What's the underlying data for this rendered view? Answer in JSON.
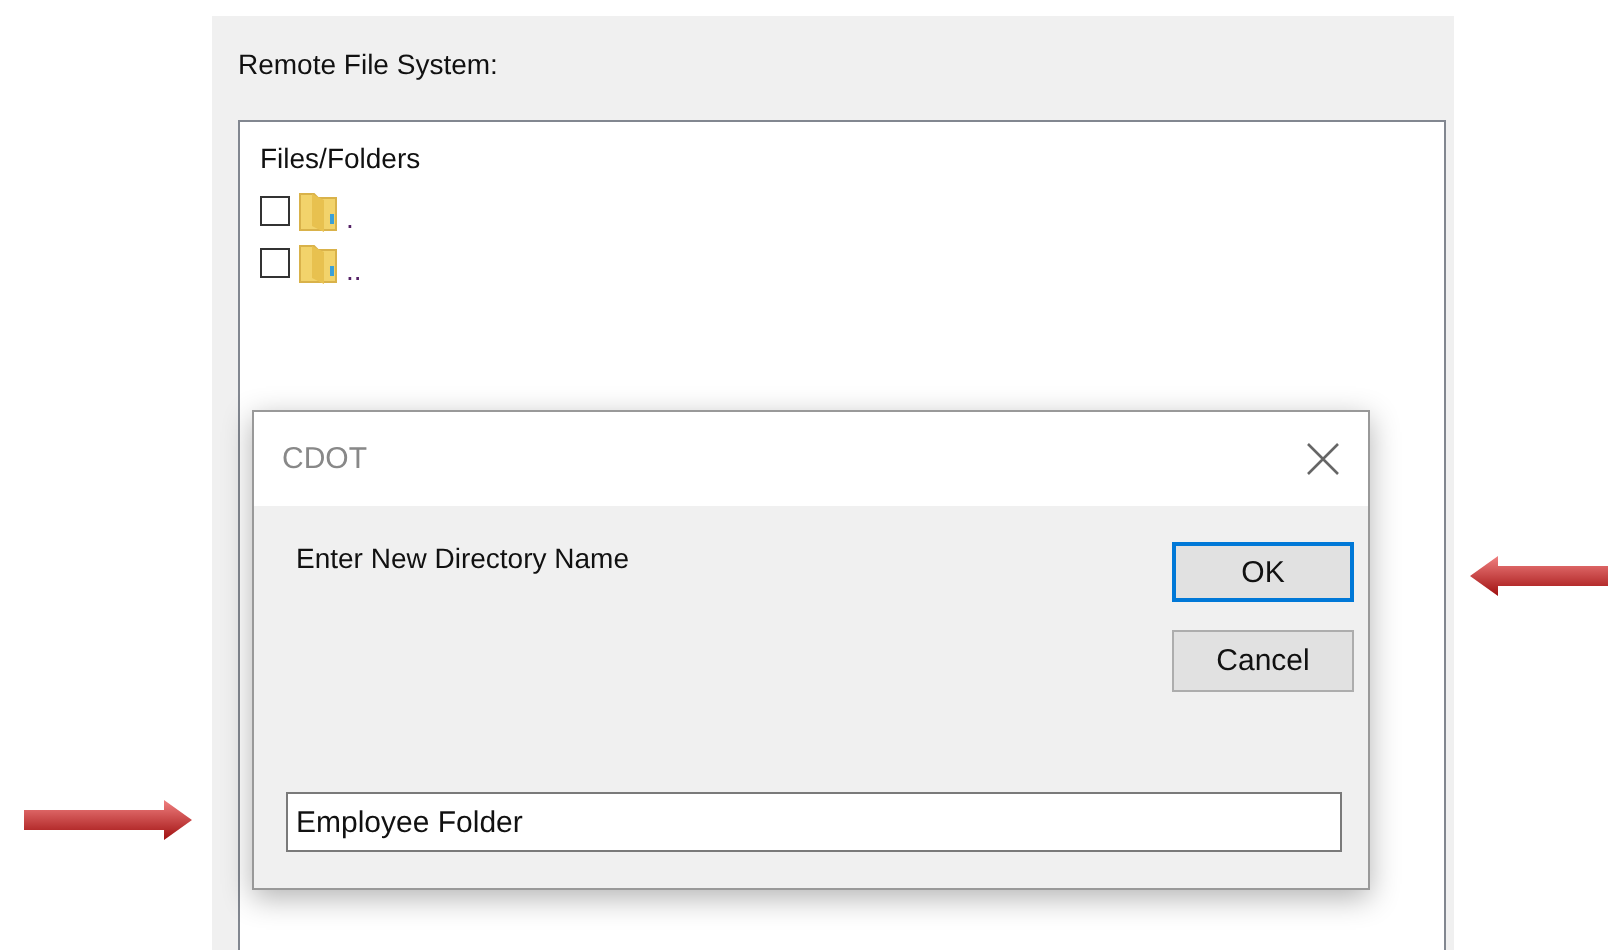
{
  "panel": {
    "label": "Remote File System:"
  },
  "file_list": {
    "header": "Files/Folders",
    "items": [
      {
        "name": ".",
        "checked": false
      },
      {
        "name": "..",
        "checked": false
      }
    ]
  },
  "dialog": {
    "title": "CDOT",
    "prompt": "Enter New Directory Name",
    "input": {
      "value": "Employee Folder"
    },
    "buttons": [
      {
        "label": "OK",
        "default": true
      },
      {
        "label": "Cancel",
        "default": false
      }
    ]
  }
}
